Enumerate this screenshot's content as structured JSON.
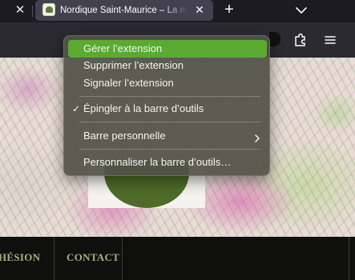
{
  "tabs": {
    "prev_close_glyph": "✕",
    "active": {
      "title": "Nordique Saint-Maurice – La ma",
      "close_glyph": "✕"
    },
    "new_tab_glyph": "+"
  },
  "site_nav": {
    "items": [
      "HÉSION",
      "CONTACT"
    ]
  },
  "context_menu": {
    "items": [
      {
        "label": "Gérer l’extension",
        "highlighted": true
      },
      {
        "label": "Supprimer l’extension"
      },
      {
        "label": "Signaler l’extension"
      },
      {
        "label": "Épingler à la barre d’outils",
        "checked": true
      },
      {
        "label": "Barre personnelle",
        "submenu": true
      },
      {
        "label": "Personnaliser la barre d’outils…"
      }
    ],
    "check_glyph": "✓"
  },
  "icons": {
    "prev_tab_close": "close-icon",
    "favicon": "site-favicon",
    "list_all_tabs": "chevron-down-icon",
    "extensions": "puzzle-piece-icon",
    "app_menu": "hamburger-menu-icon",
    "submenu": "chevron-right-icon"
  },
  "colors": {
    "menu_highlight": "#5aaa32",
    "nav_text": "#a5b27c",
    "tab_active_bg": "#42414d",
    "chrome_bg": "#1c1b22"
  }
}
